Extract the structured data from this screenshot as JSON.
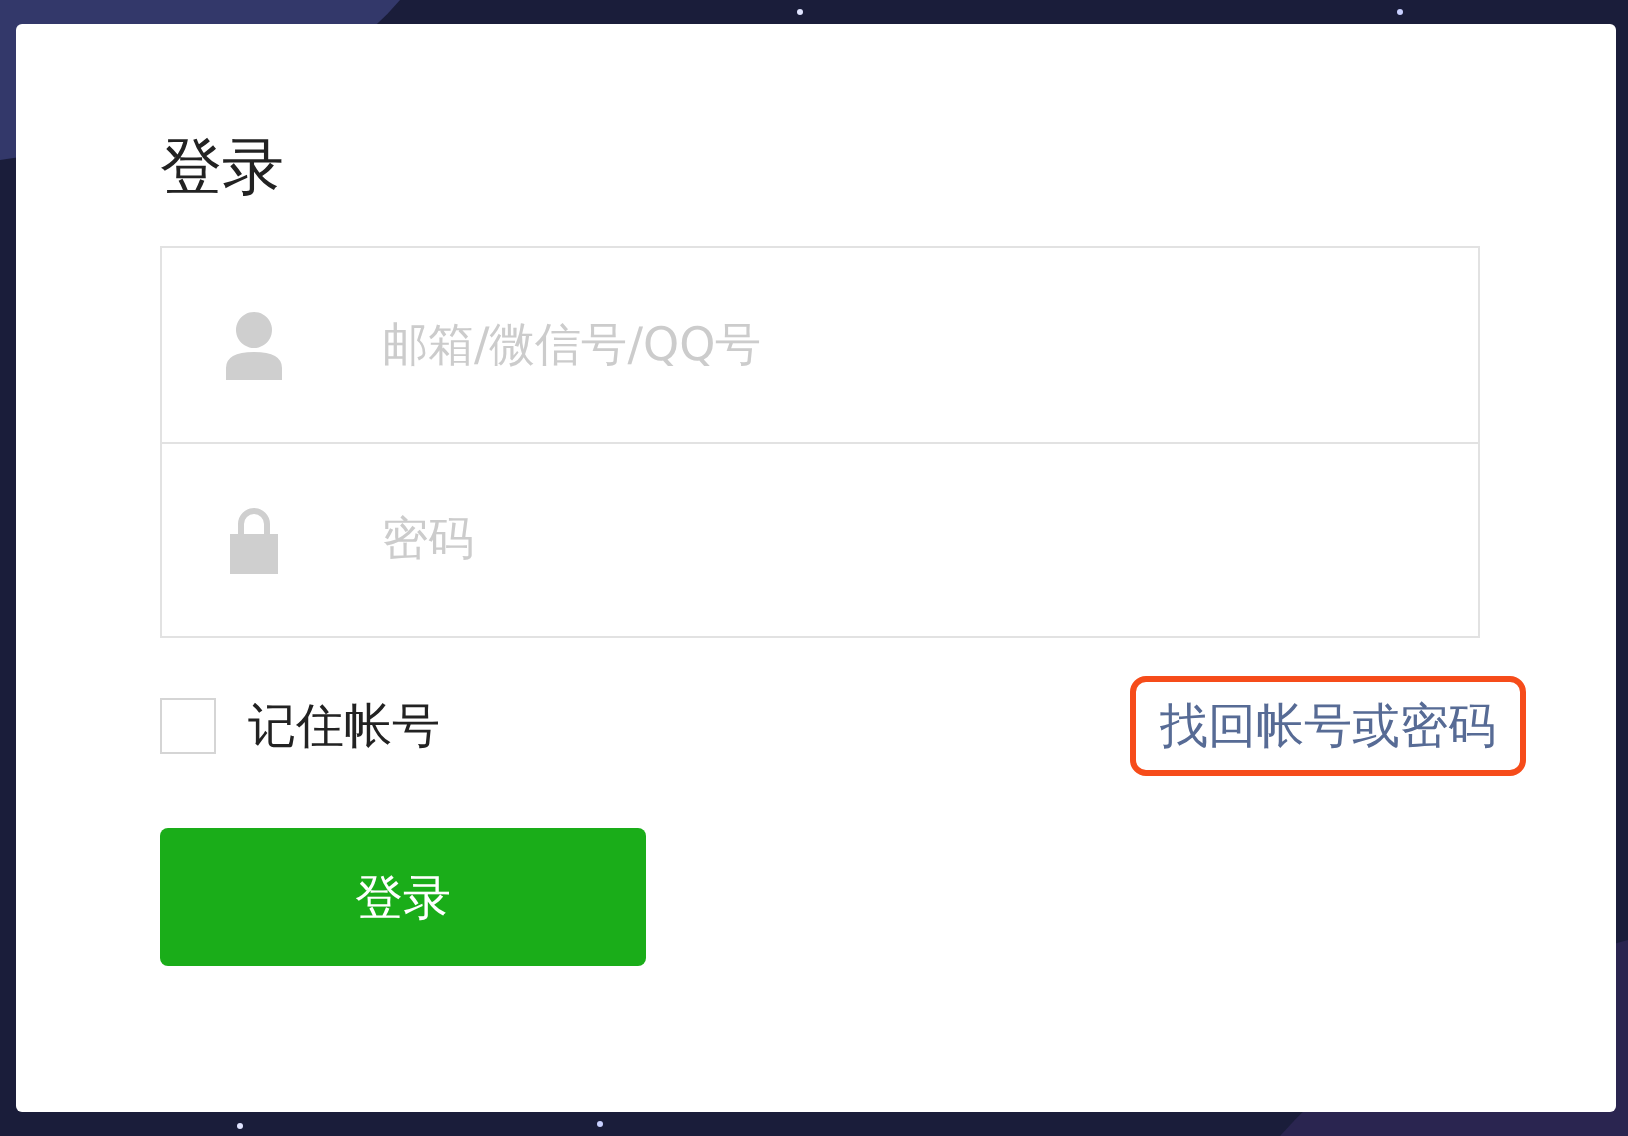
{
  "title": "登录",
  "fields": [
    {
      "kind": "account",
      "placeholder": "邮箱/微信号/QQ号"
    },
    {
      "kind": "password",
      "placeholder": "密码"
    }
  ],
  "remember": {
    "label": "记住帐号",
    "checked": false
  },
  "recover_link": {
    "label": "找回帐号或密码",
    "highlighted": true
  },
  "submit": {
    "label": "登录"
  }
}
